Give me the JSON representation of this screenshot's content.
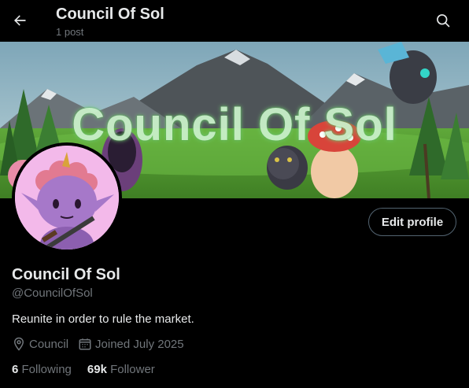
{
  "header": {
    "title": "Council Of Sol",
    "post_count": "1 post"
  },
  "banner": {
    "text": "Council Of Sol"
  },
  "profile": {
    "name": "Council Of Sol",
    "handle": "@CouncilOfSol",
    "bio": "Reunite in order to rule the market.",
    "location": "Council",
    "joined": "Joined July 2025",
    "edit_label": "Edit profile"
  },
  "stats": {
    "following_count": "6",
    "following_label": "Following",
    "follower_count": "69k",
    "follower_label": "Follower"
  },
  "icons": {
    "back": "arrow-left-icon",
    "search": "search-icon",
    "location": "location-pin-icon",
    "calendar": "calendar-icon"
  },
  "colors": {
    "background": "#000000",
    "text": "#e7e9ea",
    "secondary_text": "#71767b",
    "button_border": "#536471"
  }
}
